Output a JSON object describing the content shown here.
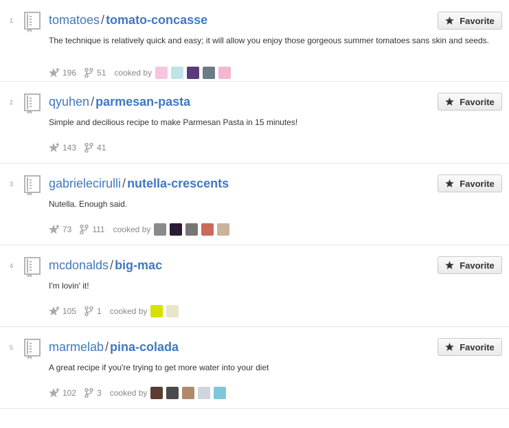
{
  "labels": {
    "favorite": "Favorite",
    "cooked_by": "cooked by"
  },
  "repos": [
    {
      "rank": "1",
      "owner": "tomatoes",
      "name": "tomato-concasse",
      "description": "The technique is relatively quick and easy; it will allow you enjoy those gorgeous summer tomatoes sans skin and seeds.",
      "stars": "196",
      "forks": "51",
      "contributors": [
        {
          "icon": "avatar-pink-identicon",
          "color": "#f6c6e0"
        },
        {
          "icon": "avatar-teal-identicon",
          "color": "#bfe3e6"
        },
        {
          "icon": "avatar-purple-art",
          "color": "#5a3b7a"
        },
        {
          "icon": "avatar-man-photo",
          "color": "#6b7c86"
        },
        {
          "icon": "avatar-pink-identicon-2",
          "color": "#f3b7cf"
        }
      ]
    },
    {
      "rank": "2",
      "owner": "qyuhen",
      "name": "parmesan-pasta",
      "description": "Simple and decilious recipe to make Parmesan Pasta in 15 minutes!",
      "stars": "143",
      "forks": "41",
      "contributors": []
    },
    {
      "rank": "3",
      "owner": "gabrielecirulli",
      "name": "nutella-crescents",
      "description": "Nutella. Enough said.",
      "stars": "73",
      "forks": "111",
      "contributors": [
        {
          "icon": "avatar-man-glasses-photo",
          "color": "#8a8a8a"
        },
        {
          "icon": "avatar-dark-purple-photo",
          "color": "#2a1a33"
        },
        {
          "icon": "avatar-grey-face-photo",
          "color": "#777777"
        },
        {
          "icon": "avatar-red-face-photo",
          "color": "#c96a5a"
        },
        {
          "icon": "avatar-landscape-photo",
          "color": "#c9b39a"
        }
      ]
    },
    {
      "rank": "4",
      "owner": "mcdonalds",
      "name": "big-mac",
      "description": "I'm lovin' it!",
      "stars": "105",
      "forks": "1",
      "contributors": [
        {
          "icon": "avatar-yellow-green-art",
          "color": "#d9e000"
        },
        {
          "icon": "avatar-sketch-face",
          "color": "#e8e6c8"
        }
      ]
    },
    {
      "rank": "5",
      "owner": "marmelab",
      "name": "pina-colada",
      "description": "A great recipe if you're trying to get more water into your diet",
      "stars": "102",
      "forks": "3",
      "contributors": [
        {
          "icon": "avatar-man-dark-photo",
          "color": "#5a3d30"
        },
        {
          "icon": "avatar-grey-photo",
          "color": "#4a4a4a"
        },
        {
          "icon": "avatar-man-suit-photo",
          "color": "#b08a6a"
        },
        {
          "icon": "avatar-pale-photo",
          "color": "#d0d4dc"
        },
        {
          "icon": "avatar-cartoon-face",
          "color": "#7fc6d8"
        }
      ]
    }
  ]
}
